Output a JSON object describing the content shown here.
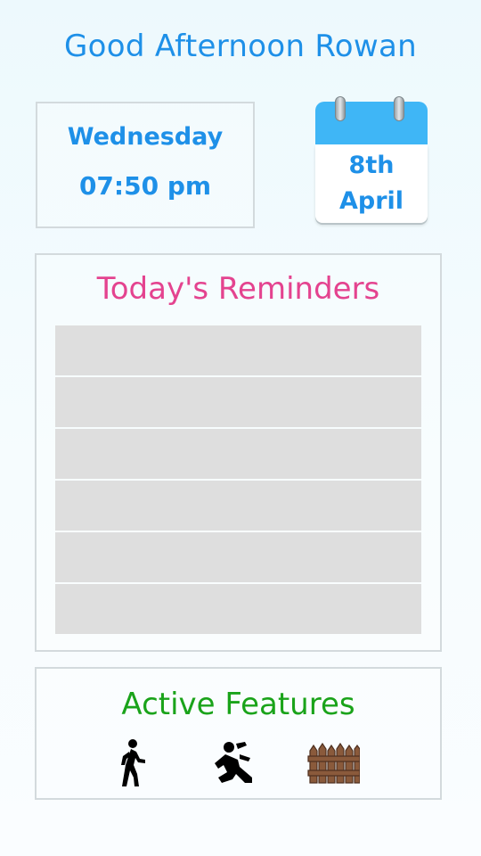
{
  "header": {
    "greeting": "Good Afternoon Rowan"
  },
  "datetime": {
    "day_name": "Wednesday",
    "time": "07:50 pm"
  },
  "calendar": {
    "day": "8th",
    "month": "April",
    "icon": "calendar-icon",
    "header_color": "#3fb6f6"
  },
  "reminders": {
    "title": "Today's Reminders",
    "items": [
      "",
      "",
      "",
      "",
      "",
      ""
    ]
  },
  "features": {
    "title": "Active Features",
    "icons": [
      "walking-person-icon",
      "falling-person-icon",
      "fence-icon"
    ]
  },
  "colors": {
    "primary_blue": "#1e90e8",
    "pink": "#e4438f",
    "green": "#1aa31a",
    "row_gray": "#dedede",
    "border": "#d3dadd"
  }
}
